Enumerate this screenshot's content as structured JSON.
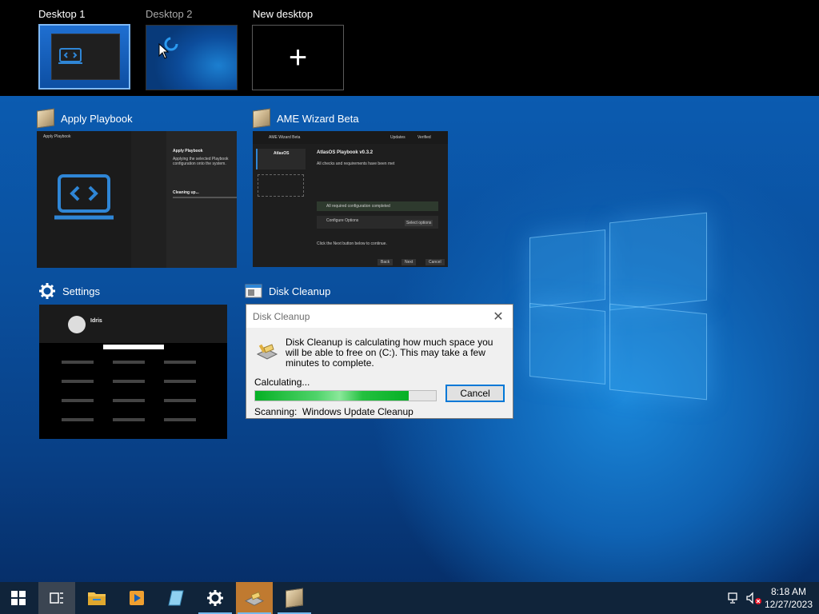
{
  "desktops": {
    "items": [
      {
        "label": "Desktop 1"
      },
      {
        "label": "Desktop 2"
      },
      {
        "label": "New desktop"
      }
    ],
    "new_symbol": "+"
  },
  "windows": {
    "apply_playbook": {
      "title": "Apply Playbook",
      "thumb": {
        "titlebar": "Apply Playbook",
        "heading": "Apply Playbook",
        "desc": "Applying the selected Playbook configuration onto the system.",
        "status": "Cleaning up..."
      }
    },
    "ame_wizard": {
      "title": "AME Wizard Beta",
      "thumb": {
        "titlebar": "AME Wizard Beta",
        "updates": "Updates",
        "verified": "Verified",
        "sidebar_name": "AtlasOS",
        "heading": "AtlasOS Playbook v0.3.2",
        "checks": "All checks and requirements have been met",
        "row1": "All required configuration completed",
        "row2": "Configure Options",
        "select_options": "Select options",
        "footer": "Click the Next button below to continue.",
        "back": "Back",
        "next": "Next",
        "cancel": "Cancel"
      }
    },
    "settings": {
      "title": "Settings",
      "thumb": {
        "user": "Idris"
      }
    },
    "disk_cleanup": {
      "title": "Disk Cleanup",
      "dialog": {
        "title": "Disk Cleanup",
        "close": "✕",
        "message": "Disk Cleanup is calculating how much space you will be able to free on  (C:). This may take a few minutes to complete.",
        "calculating": "Calculating...",
        "cancel": "Cancel",
        "scanning_label": "Scanning:",
        "scanning_item": "Windows Update Cleanup",
        "progress": 0.85
      }
    }
  },
  "taskbar": {
    "time": "8:18 AM",
    "date": "12/27/2023",
    "items": [
      "start-icon",
      "task-view-icon",
      "file-explorer-icon",
      "media-player-icon",
      "notepad-icon",
      "settings-icon",
      "disk-cleanup-icon",
      "ame-wizard-icon"
    ],
    "accent": "#76b9ed"
  },
  "colors": {
    "progress": "#06b025",
    "button_focus": "#0078d7",
    "accent_blue": "#0b5bb0"
  }
}
